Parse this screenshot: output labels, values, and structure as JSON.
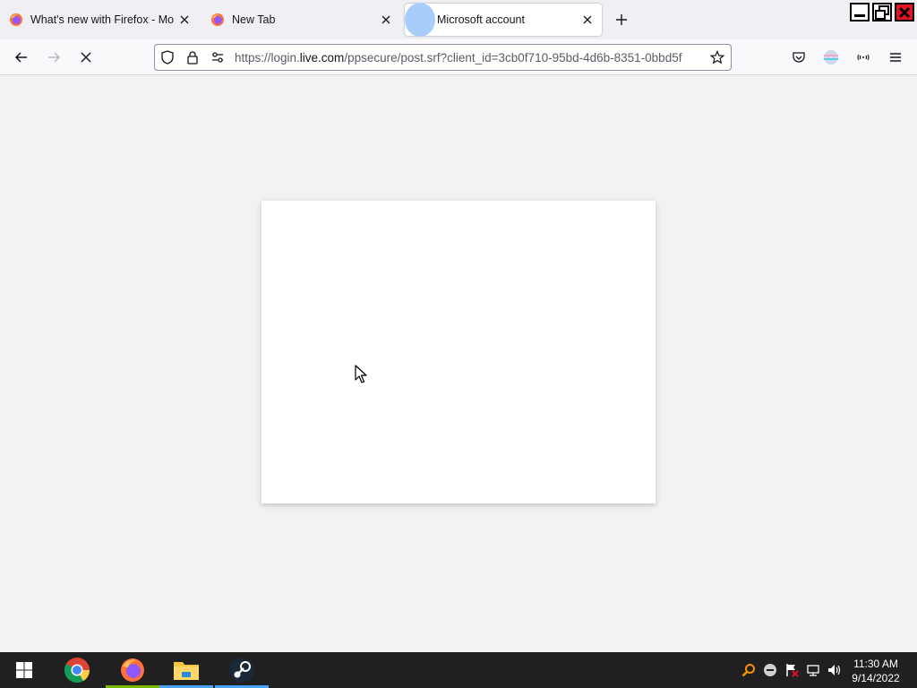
{
  "browser": {
    "tabs": [
      {
        "title": "What's new with Firefox - More",
        "favicon": "firefox-icon",
        "active": false
      },
      {
        "title": "New Tab",
        "favicon": "firefox-icon",
        "active": false
      },
      {
        "title": "Microsoft account",
        "favicon": "loading-icon",
        "active": true
      }
    ],
    "url": {
      "prefix": "https://login.",
      "host": "live.com",
      "path": "/ppsecure/post.srf?client_id=3cb0f710-95bd-4d6b-8351-0bbd5f"
    },
    "icons": {
      "back": "back-arrow-icon",
      "forward": "forward-arrow-icon",
      "stop": "stop-icon",
      "shield": "shield-icon",
      "lock": "lock-icon",
      "permissions": "permissions-icon",
      "bookmark": "star-icon",
      "pocket": "pocket-icon",
      "account": "account-icon",
      "extensions": "extensions-icon",
      "menu": "hamburger-menu-icon"
    }
  },
  "taskbar": {
    "apps": [
      "start-icon",
      "chrome-icon",
      "firefox-icon",
      "file-explorer-icon",
      "steam-icon"
    ],
    "clock": {
      "time": "11:30 AM",
      "date": "9/14/2022"
    }
  },
  "colors": {
    "accent_active_tab_orb": "#a9cdfb",
    "taskbar": "#202020",
    "content_bg": "#f2f2f2"
  }
}
